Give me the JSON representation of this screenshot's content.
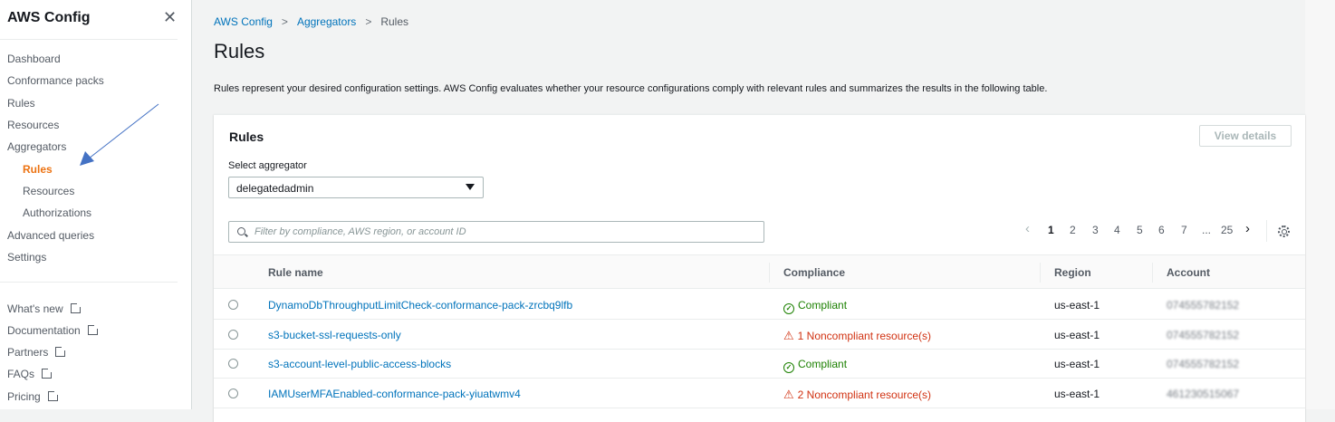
{
  "sidebar": {
    "title": "AWS Config",
    "items": [
      "Dashboard",
      "Conformance packs",
      "Rules",
      "Resources",
      "Aggregators"
    ],
    "sub_items": [
      "Rules",
      "Resources",
      "Authorizations"
    ],
    "items2": [
      "Advanced queries",
      "Settings"
    ],
    "links": [
      "What's new",
      "Documentation",
      "Partners",
      "FAQs",
      "Pricing"
    ]
  },
  "breadcrumb": [
    "AWS Config",
    "Aggregators",
    "Rules"
  ],
  "page": {
    "title": "Rules",
    "description": "Rules represent your desired configuration settings. AWS Config evaluates whether your resource configurations comply with relevant rules and summarizes the results in the following table."
  },
  "card": {
    "title": "Rules",
    "view_details": "View details",
    "select_label": "Select aggregator",
    "select_value": "delegatedadmin",
    "filter_placeholder": "Filter by compliance, AWS region, or account ID"
  },
  "pagination": {
    "pages": [
      "1",
      "2",
      "3",
      "4",
      "5",
      "6",
      "7",
      "...",
      "25"
    ],
    "current": "1"
  },
  "table": {
    "headers": [
      "Rule name",
      "Compliance",
      "Region",
      "Account"
    ],
    "rows": [
      {
        "name": "DynamoDbThroughputLimitCheck-conformance-pack-zrcbq9lfb",
        "compliance": "Compliant",
        "status": "ok",
        "region": "us-east-1",
        "account": "074555782152"
      },
      {
        "name": "s3-bucket-ssl-requests-only",
        "compliance": "1 Noncompliant resource(s)",
        "status": "bad",
        "region": "us-east-1",
        "account": "074555782152"
      },
      {
        "name": "s3-account-level-public-access-blocks",
        "compliance": "Compliant",
        "status": "ok",
        "region": "us-east-1",
        "account": "074555782152"
      },
      {
        "name": "IAMUserMFAEnabled-conformance-pack-yiuatwmv4",
        "compliance": "2 Noncompliant resource(s)",
        "status": "bad",
        "region": "us-east-1",
        "account": "461230515067"
      }
    ]
  }
}
